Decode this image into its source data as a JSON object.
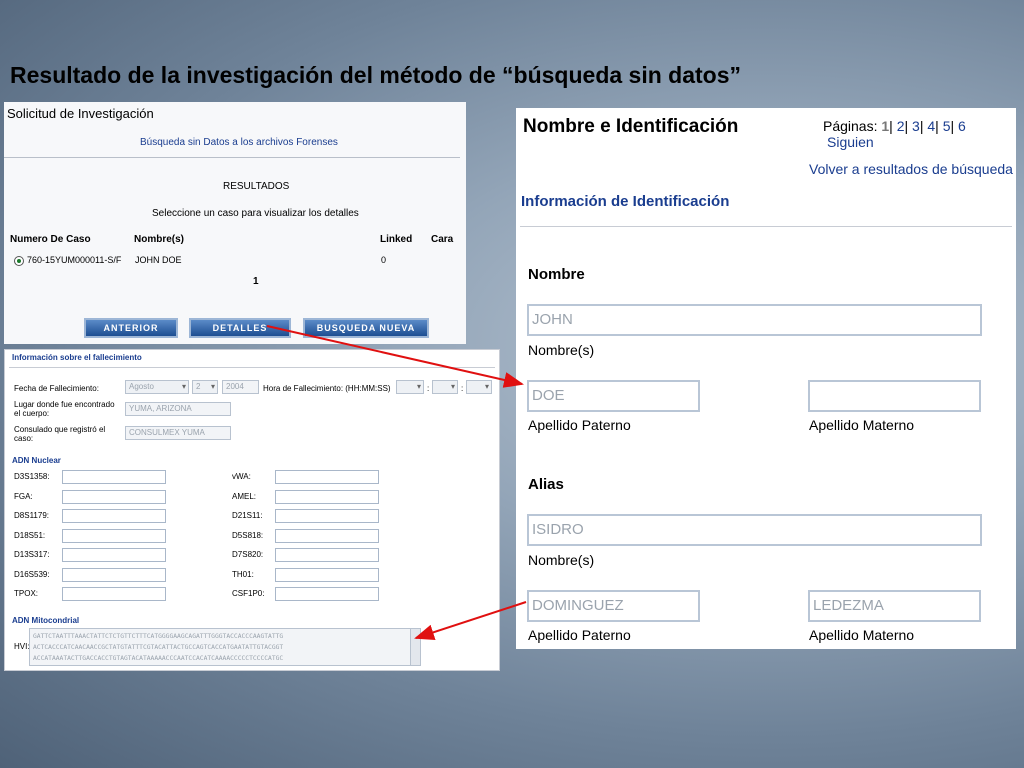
{
  "slide_title": "Resultado de la investigación del método de “búsqueda sin datos”",
  "search_panel": {
    "title": "Solicitud de Investigación",
    "subtitle": "Búsqueda sin Datos a los archivos Forenses",
    "results_heading": "RESULTADOS",
    "instruction": "Seleccione un caso para visualizar los detalles",
    "columns": [
      "Numero De Caso",
      "Nombre(s)",
      "Linked",
      "Cara"
    ],
    "row": {
      "case": "760-15YUM000011-S/F",
      "name": "JOHN DOE",
      "linked": "0"
    },
    "page": "1",
    "buttons": {
      "previous": "ANTERIOR",
      "details": "DETALLES",
      "new_search": "BUSQUEDA NUEVA"
    }
  },
  "death_panel": {
    "title": "Información sobre el fallecimiento",
    "date_label": "Fecha de Fallecimiento:",
    "month": "Agosto",
    "day": "2",
    "year": "2004",
    "time_label": "Hora de Fallecimiento: (HH:MM:SS)",
    "time_sep1": ":",
    "time_sep2": ":",
    "place_label_1": "Lugar donde fue encontrado",
    "place_label_2": "el cuerpo:",
    "place_value": "YUMA, ARIZONA",
    "consulate_label_1": "Consulado que registró el",
    "consulate_label_2": "caso:",
    "consulate_value": "CONSULMEX YUMA",
    "nuclear_title": "ADN Nuclear",
    "markers_left": [
      "D3S1358:",
      "FGA:",
      "D8S1179:",
      "D18S51:",
      "D13S317:",
      "D16S539:",
      "TPOX:"
    ],
    "markers_right": [
      "vWA:",
      "AMEL:",
      "D21S11:",
      "D5S818:",
      "D7S820:",
      "TH01:",
      "CSF1P0:"
    ],
    "mito_title": "ADN Mitocondrial",
    "hvi_label": "HVI:",
    "hvi_lines": [
      "GATTCTAATTTAAACTATTCTCTGTTCTTTCATGGGGAAGCAGATTTGGGTACCACCCAAGTATTG",
      "ACTCACCCATCAACAACCGCTATGTATTTCGTACATTACTGCCAGTCACCATGAATATTGTACGGT",
      "ACCATAAATACTTGACCACCTGTAGTACATAAAAACCCAATCCACATCAAAACCCCCTCCCCATGC"
    ]
  },
  "id_panel": {
    "title": "Nombre e Identificación",
    "pages_label": "Páginas:",
    "pages": [
      "1",
      "2",
      "3",
      "4",
      "5",
      "6"
    ],
    "next": "Siguien",
    "back_link": "Volver a resultados de búsqueda",
    "section": "Información de Identificación",
    "name_heading": "Nombre",
    "first_name": "JOHN",
    "first_name_label": "Nombre(s)",
    "paternal": "DOE",
    "paternal_label": "Apellido Paterno",
    "maternal": "",
    "maternal_label": "Apellido Materno",
    "alias_heading": "Alias",
    "alias_first": "ISIDRO",
    "alias_first_label": "Nombre(s)",
    "alias_paternal": "DOMINGUEZ",
    "alias_paternal_label": "Apellido Paterno",
    "alias_maternal": "LEDEZMA",
    "alias_maternal_label": "Apellido Materno"
  },
  "colors": {
    "link_blue": "#1a3d8f",
    "arrow_red": "#e01010",
    "button_blue": "#1d4e92"
  }
}
